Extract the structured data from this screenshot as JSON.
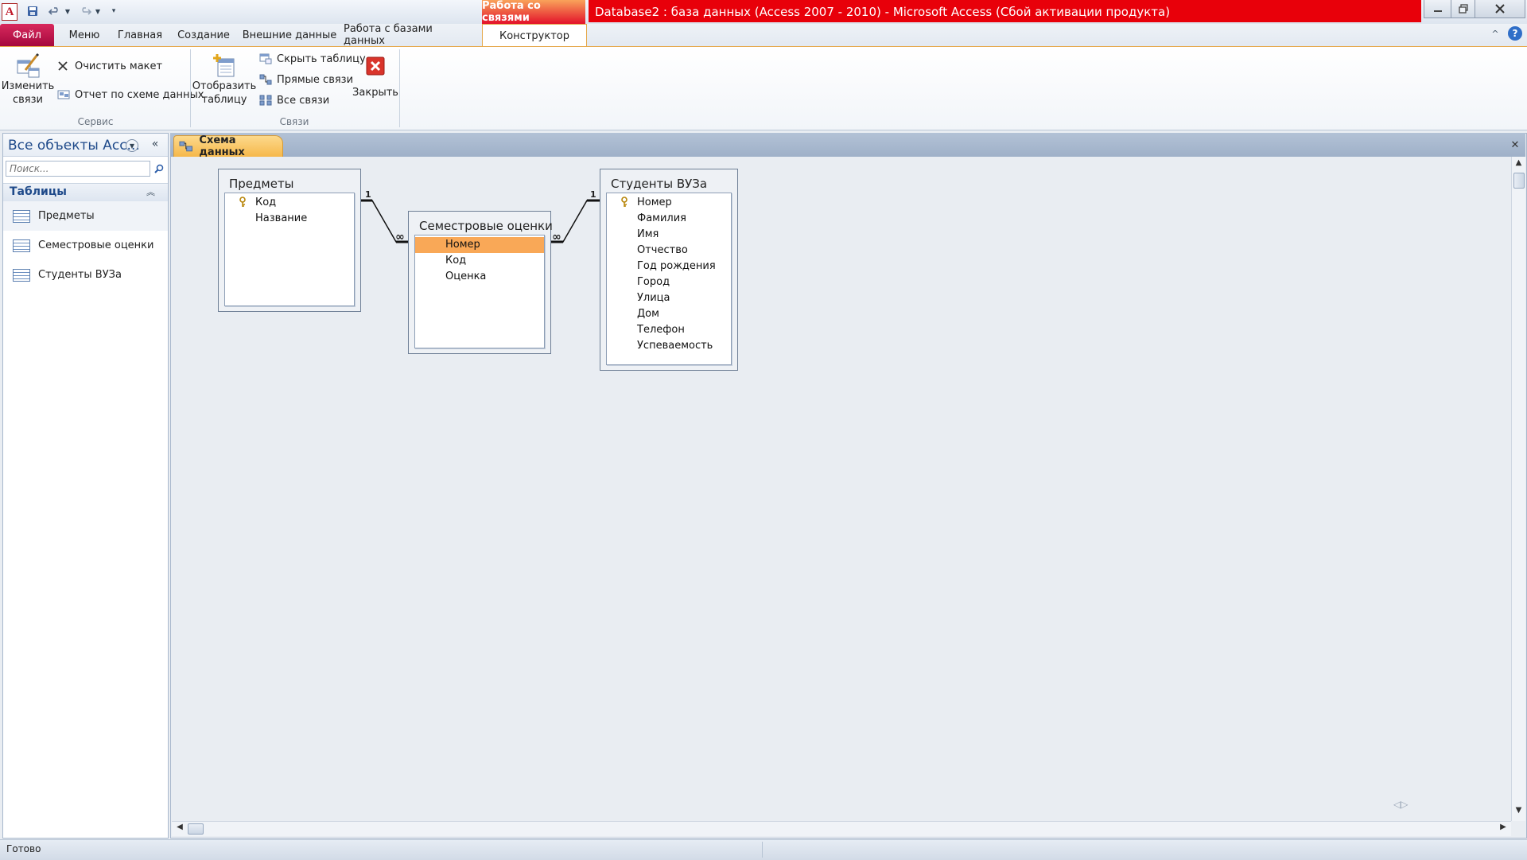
{
  "window": {
    "context_group_label": "Работа со связями",
    "title": "Database2 : база данных (Access 2007 - 2010)  -  Microsoft Access (Сбой активации продукта)",
    "app_icon_letter": "A"
  },
  "ribbon_tabs": {
    "file": "Файл",
    "menu": "Меню",
    "home": "Главная",
    "create": "Создание",
    "external": "Внешние данные",
    "dbtools": "Работа с базами данных",
    "design": "Конструктор"
  },
  "ribbon": {
    "tools_group": "Сервис",
    "edit_relations_line1": "Изменить",
    "edit_relations_line2": "связи",
    "clear_layout": "Очистить макет",
    "relationship_report": "Отчет по схеме данных",
    "relations_group": "Связи",
    "show_table_line1": "Отобразить",
    "show_table_line2": "таблицу",
    "hide_table": "Скрыть таблицу",
    "direct_relations": "Прямые связи",
    "all_relations": "Все связи",
    "close": "Закрыть"
  },
  "nav": {
    "title": "Все объекты Асс...",
    "search_placeholder": "Поиск...",
    "group": "Таблицы",
    "items": [
      "Предметы",
      "Семестровые оценки",
      "Студенты ВУЗа"
    ]
  },
  "document": {
    "tab_label": "Схема данных"
  },
  "tables": {
    "subjects": {
      "title": "Предметы",
      "fields": [
        "Код",
        "Название"
      ],
      "key_field": "Код"
    },
    "grades": {
      "title": "Семестровые оценки",
      "fields": [
        "Номер",
        "Код",
        "Оценка"
      ],
      "selected_field": "Номер"
    },
    "students": {
      "title": "Студенты ВУЗа",
      "fields": [
        "Номер",
        "Фамилия",
        "Имя",
        "Отчество",
        "Год рождения",
        "Город",
        "Улица",
        "Дом",
        "Телефон",
        "Успеваемость"
      ],
      "key_field": "Номер"
    }
  },
  "relations": {
    "one_label": "1",
    "many_label": "∞"
  },
  "status": {
    "text": "Готово"
  }
}
